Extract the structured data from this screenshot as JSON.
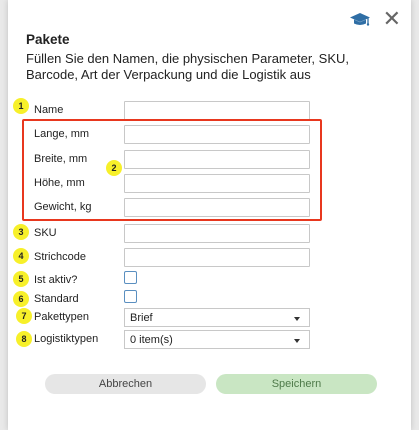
{
  "colors": {
    "badge": "#f7f02a",
    "highlight_border": "#e8371e",
    "save_button_bg": "#c9e6c3",
    "cancel_button_bg": "#e6e6e6",
    "checkbox_border": "#5a8fc0"
  },
  "dialog": {
    "title": "Pakete",
    "description": "Füllen Sie den Namen, die physischen Parameter, SKU, Barcode, Art der Verpackung und die Logistik aus",
    "icons": {
      "help": "graduation-cap-icon",
      "close": "close-icon"
    }
  },
  "form": {
    "name": {
      "label": "Name",
      "badge": "1",
      "value": ""
    },
    "dimensions_badge": "2",
    "length": {
      "label": "Lange, mm",
      "value": ""
    },
    "width": {
      "label": "Breite, mm",
      "value": ""
    },
    "height": {
      "label": "Höhe, mm",
      "value": ""
    },
    "weight": {
      "label": "Gewicht, kg",
      "value": ""
    },
    "sku": {
      "label": "SKU",
      "badge": "3",
      "value": ""
    },
    "barcode": {
      "label": "Strichcode",
      "badge": "4",
      "value": ""
    },
    "active": {
      "label": "Ist aktiv?",
      "badge": "5",
      "checked": false
    },
    "default": {
      "label": "Standard",
      "badge": "6",
      "checked": false
    },
    "package_type": {
      "label": "Pakettypen",
      "badge": "7",
      "selected": "Brief"
    },
    "logistics_type": {
      "label": "Logistiktypen",
      "badge": "8",
      "selected": "0 item(s)"
    }
  },
  "buttons": {
    "cancel": "Abbrechen",
    "save": "Speichern"
  }
}
